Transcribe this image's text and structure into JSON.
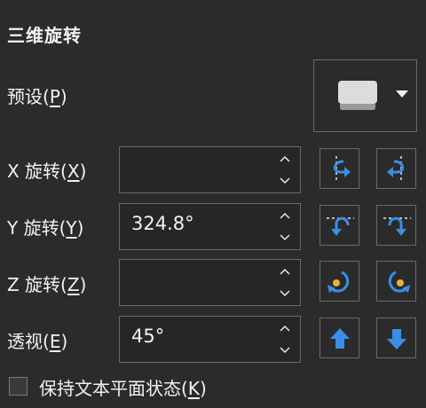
{
  "panel": {
    "title": "三维旋转"
  },
  "preset": {
    "label_text": "预设(",
    "label_key": "P",
    "label_end": ")"
  },
  "x_rotation": {
    "label_text": "X 旋转(",
    "label_key": "X",
    "label_end": ")",
    "value": ""
  },
  "y_rotation": {
    "label_text": "Y 旋转(",
    "label_key": "Y",
    "label_end": ")",
    "value": "324.8°"
  },
  "z_rotation": {
    "label_text": "Z 旋转(",
    "label_key": "Z",
    "label_end": ")",
    "value": ""
  },
  "perspective": {
    "label_text": "透视(",
    "label_key": "E",
    "label_end": ")",
    "value": "45°"
  },
  "keep_text_flat": {
    "label_text": "保持文本平面状态(",
    "label_key": "K",
    "label_end": ")",
    "checked": false
  },
  "icons": {
    "accent": "#3a8ee6",
    "glyph": "#e8e8e8",
    "preset": "flat-box-preset-icon",
    "x_left": "rotate-left-x-icon",
    "x_right": "rotate-right-x-icon",
    "y_up": "rotate-up-y-icon",
    "y_down": "rotate-down-y-icon",
    "z_counter": "rotate-counterclockwise-z-icon",
    "z_clockwise": "rotate-clockwise-z-icon",
    "persp_increase": "arrow-up-icon",
    "persp_decrease": "arrow-down-icon"
  }
}
